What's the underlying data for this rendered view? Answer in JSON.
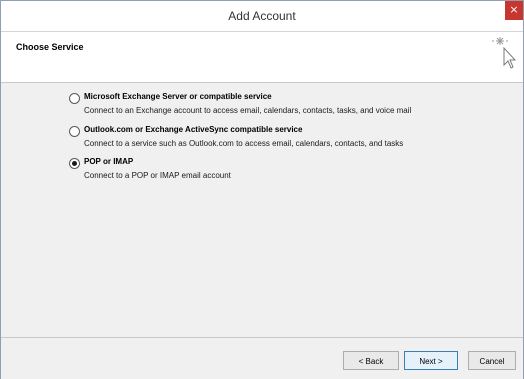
{
  "window": {
    "title": "Add Account",
    "close_glyph": "×"
  },
  "header": {
    "title": "Choose Service",
    "icon": "cursor-sparkle-icon"
  },
  "options": [
    {
      "label": "Microsoft Exchange Server or compatible service",
      "description": "Connect to an Exchange account to access email, calendars, contacts, tasks, and voice mail",
      "selected": false
    },
    {
      "label": "Outlook.com or Exchange ActiveSync compatible service",
      "description": "Connect to a service such as Outlook.com to access email, calendars, contacts, and tasks",
      "selected": false
    },
    {
      "label": "POP or IMAP",
      "description": "Connect to a POP or IMAP email account",
      "selected": true
    }
  ],
  "footer": {
    "back_label": "< Back",
    "next_label": "Next >",
    "cancel_label": "Cancel"
  }
}
